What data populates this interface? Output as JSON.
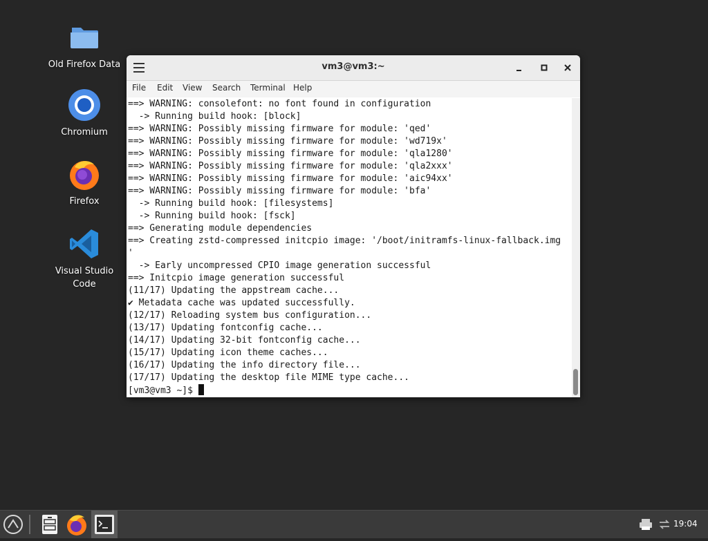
{
  "desktop": {
    "icons": [
      {
        "label": "Old Firefox Data",
        "icon": "folder-icon"
      },
      {
        "label": "Chromium",
        "icon": "chromium-icon"
      },
      {
        "label": "Firefox",
        "icon": "firefox-icon"
      },
      {
        "label": "Visual Studio Code",
        "icon": "vscode-icon"
      }
    ]
  },
  "window": {
    "title": "vm3@vm3:~",
    "menu": [
      "File",
      "Edit",
      "View",
      "Search",
      "Terminal",
      "Help"
    ]
  },
  "terminal": {
    "lines": [
      "==> WARNING: consolefont: no font found in configuration",
      "  -> Running build hook: [block]",
      "==> WARNING: Possibly missing firmware for module: 'qed'",
      "==> WARNING: Possibly missing firmware for module: 'wd719x'",
      "==> WARNING: Possibly missing firmware for module: 'qla1280'",
      "==> WARNING: Possibly missing firmware for module: 'qla2xxx'",
      "==> WARNING: Possibly missing firmware for module: 'aic94xx'",
      "==> WARNING: Possibly missing firmware for module: 'bfa'",
      "  -> Running build hook: [filesystems]",
      "  -> Running build hook: [fsck]",
      "==> Generating module dependencies",
      "==> Creating zstd-compressed initcpio image: '/boot/initramfs-linux-fallback.img",
      "'",
      "  -> Early uncompressed CPIO image generation successful",
      "==> Initcpio image generation successful",
      "(11/17) Updating the appstream cache...",
      "✔ Metadata cache was updated successfully.",
      "(12/17) Reloading system bus configuration...",
      "(13/17) Updating fontconfig cache...",
      "(14/17) Updating 32-bit fontconfig cache...",
      "(15/17) Updating icon theme caches...",
      "(16/17) Updating the info directory file...",
      "(17/17) Updating the desktop file MIME type cache..."
    ],
    "prompt": "[vm3@vm3 ~]$ "
  },
  "taskbar": {
    "clock": "19:04",
    "items": [
      "menu-icon",
      "file-manager-icon",
      "firefox-icon",
      "terminal-icon"
    ]
  },
  "colors": {
    "desktop_bg": "#262626",
    "taskbar_bg": "#3a3a3a",
    "folder_blue": "#6aa5e6",
    "vscode_blue": "#2a8cdb",
    "chromium_blue": "#4d8ee8"
  }
}
